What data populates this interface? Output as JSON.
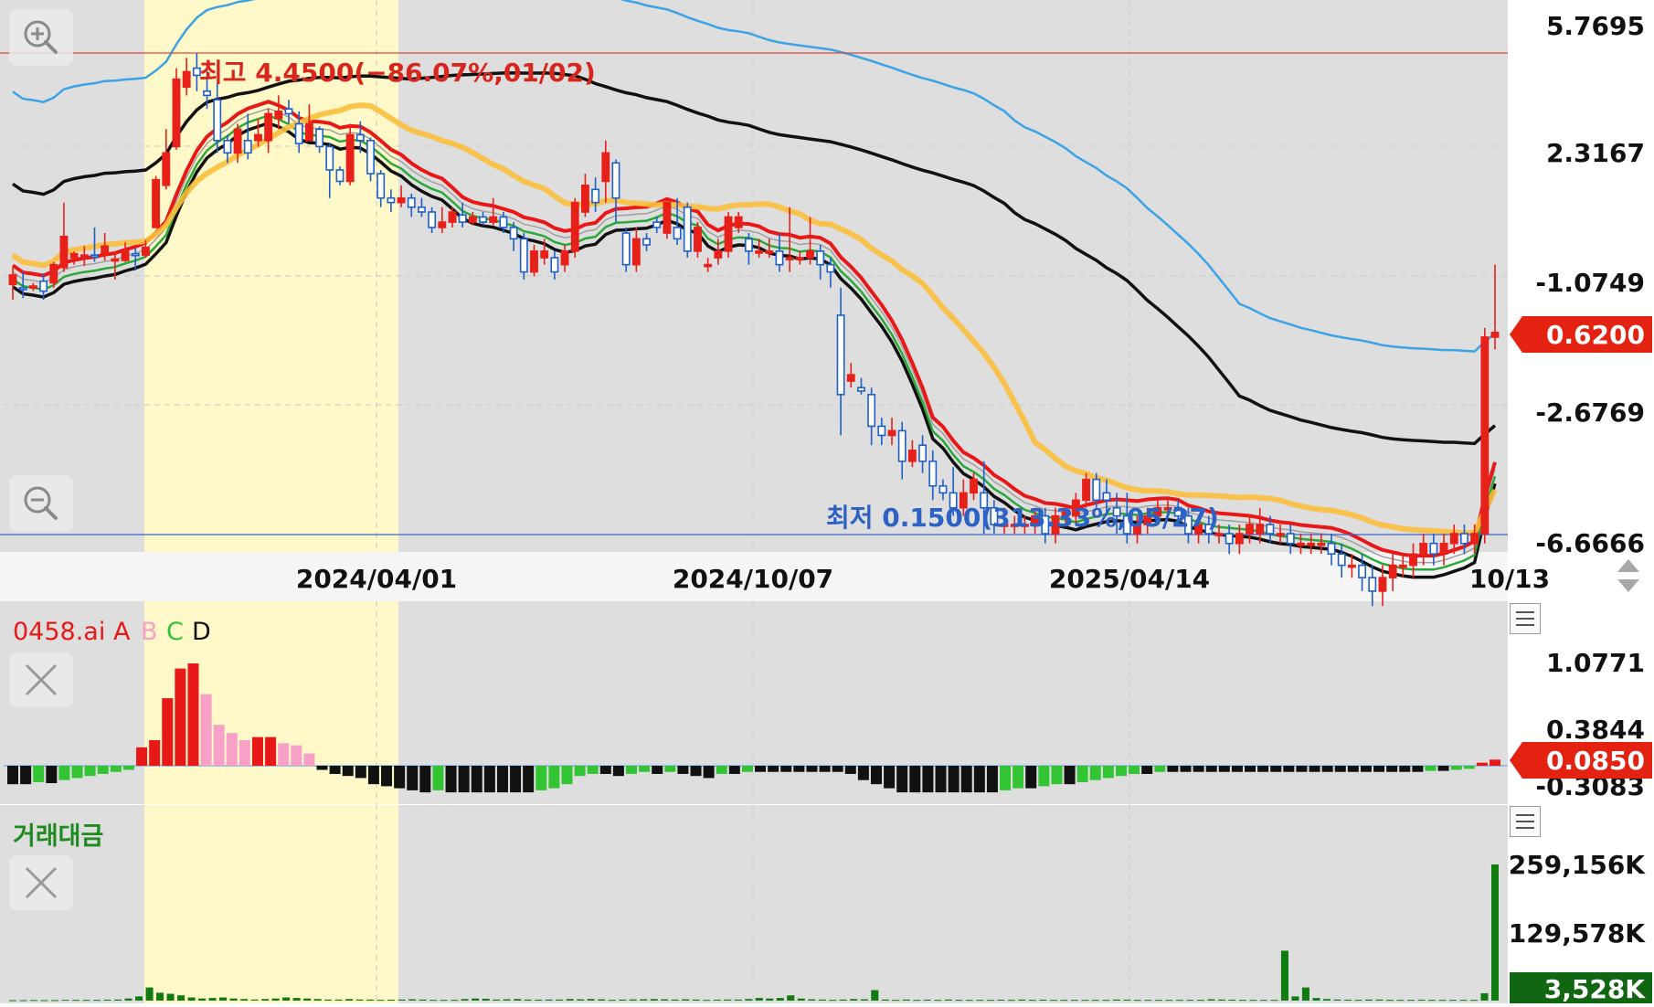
{
  "colors": {
    "up": "#e8201a",
    "down": "#1e5fc8",
    "panel_bg": "#dedede",
    "highlight_bg": "#fff8c8",
    "ma_yellow": "#fbbf3c",
    "ma_red": "#e81818",
    "ma_green": "#2aa838",
    "ma_gray": "#a0a0a0",
    "band_black": "#111111",
    "band_blue": "#3ba3e6",
    "osc_red": "#e81818",
    "osc_pink": "#f7a0c8",
    "osc_green": "#33c433",
    "osc_black": "#111111",
    "volume_green": "#107c10"
  },
  "icons": {
    "zoom_in": "zoom-in-icon",
    "zoom_out": "zoom-out-icon",
    "close": "close-icon",
    "menu": "menu-icon",
    "scroll": "up-down-arrows-icon"
  },
  "chart_data": [
    {
      "type": "candlestick",
      "name": "price",
      "y_axis_labels": [
        "5.7695",
        "2.3167",
        "-1.0749",
        "-2.6769",
        "-6.6666"
      ],
      "x_axis_labels": [
        "2024/04/01",
        "2024/10/07",
        "2025/04/14",
        "10/13"
      ],
      "current_price_label": "0.6200",
      "high_annotation": "최고 4.4500(−86.07%,01/02)",
      "low_annotation": "최저 0.1500(313.33%,05/27)",
      "high_value": 4.45,
      "low_value": 0.15,
      "current_value": 0.62,
      "candles": [
        [
          0.87,
          0.93,
          0.98,
          0.78
        ],
        [
          0.85,
          0.84,
          0.95,
          0.79
        ],
        [
          0.86,
          0.86,
          0.88,
          0.83
        ],
        [
          0.89,
          0.83,
          0.94,
          0.78
        ],
        [
          0.88,
          1.0,
          1.02,
          0.85
        ],
        [
          0.98,
          1.22,
          1.55,
          0.95
        ],
        [
          1.05,
          1.08,
          1.1,
          1.0
        ],
        [
          1.07,
          1.07,
          1.14,
          0.99
        ],
        [
          1.07,
          1.06,
          1.3,
          1.02
        ],
        [
          1.08,
          1.14,
          1.25,
          1.03
        ],
        [
          1.04,
          1.04,
          1.1,
          0.9
        ],
        [
          1.03,
          1.1,
          1.17,
          1.02
        ],
        [
          1.08,
          1.07,
          1.12,
          0.96
        ],
        [
          1.07,
          1.13,
          1.19,
          1.05
        ],
        [
          1.3,
          1.82,
          1.87,
          1.3
        ],
        [
          1.75,
          2.2,
          2.6,
          1.7
        ],
        [
          2.3,
          3.7,
          4.0,
          2.25
        ],
        [
          3.5,
          3.9,
          4.3,
          3.3
        ],
        [
          4.0,
          3.8,
          4.45,
          3.4
        ],
        [
          3.4,
          3.3,
          4.1,
          3.0
        ],
        [
          3.2,
          2.4,
          3.6,
          2.2
        ],
        [
          2.4,
          2.2,
          2.5,
          2.05
        ],
        [
          2.2,
          2.6,
          2.7,
          2.05
        ],
        [
          2.4,
          2.2,
          2.9,
          2.1
        ],
        [
          2.4,
          2.5,
          2.8,
          2.3
        ],
        [
          2.4,
          2.9,
          3.0,
          2.2
        ],
        [
          2.8,
          2.95,
          3.3,
          2.6
        ],
        [
          3.0,
          2.9,
          3.2,
          2.7
        ],
        [
          2.7,
          2.35,
          2.95,
          2.2
        ],
        [
          2.4,
          2.7,
          3.1,
          2.4
        ],
        [
          2.6,
          2.3,
          2.65,
          2.2
        ],
        [
          2.3,
          1.95,
          2.35,
          1.6
        ],
        [
          1.95,
          1.8,
          2.0,
          1.75
        ],
        [
          1.8,
          2.5,
          2.7,
          1.75
        ],
        [
          2.5,
          2.4,
          2.75,
          2.2
        ],
        [
          2.4,
          1.9,
          2.45,
          1.8
        ],
        [
          1.9,
          1.6,
          1.95,
          1.5
        ],
        [
          1.6,
          1.55,
          1.7,
          1.45
        ],
        [
          1.55,
          1.6,
          1.75,
          1.5
        ],
        [
          1.6,
          1.5,
          1.65,
          1.4
        ],
        [
          1.5,
          1.45,
          1.6,
          1.4
        ],
        [
          1.45,
          1.3,
          1.5,
          1.25
        ],
        [
          1.3,
          1.35,
          1.5,
          1.25
        ],
        [
          1.35,
          1.45,
          1.5,
          1.3
        ],
        [
          1.42,
          1.35,
          1.55,
          1.3
        ],
        [
          1.35,
          1.4,
          1.45,
          1.32
        ],
        [
          1.4,
          1.35,
          1.45,
          1.32
        ],
        [
          1.35,
          1.4,
          1.6,
          1.32
        ],
        [
          1.4,
          1.3,
          1.45,
          1.25
        ],
        [
          1.3,
          1.2,
          1.35,
          1.1
        ],
        [
          1.2,
          0.95,
          1.25,
          0.9
        ],
        [
          0.95,
          1.1,
          1.15,
          0.92
        ],
        [
          1.05,
          1.1,
          1.2,
          1.0
        ],
        [
          1.05,
          0.95,
          1.1,
          0.9
        ],
        [
          1.0,
          1.1,
          1.15,
          0.95
        ],
        [
          1.1,
          1.55,
          1.6,
          1.05
        ],
        [
          1.45,
          1.75,
          1.9,
          1.4
        ],
        [
          1.7,
          1.55,
          1.85,
          1.45
        ],
        [
          1.8,
          2.2,
          2.4,
          1.55
        ],
        [
          2.05,
          1.6,
          2.1,
          1.35
        ],
        [
          1.25,
          1.0,
          1.3,
          0.95
        ],
        [
          1.0,
          1.2,
          1.3,
          0.95
        ],
        [
          1.2,
          1.15,
          1.25,
          1.1
        ],
        [
          1.35,
          1.3,
          1.4,
          1.25
        ],
        [
          1.25,
          1.55,
          1.6,
          1.2
        ],
        [
          1.3,
          1.2,
          1.6,
          1.15
        ],
        [
          1.5,
          1.1,
          1.55,
          1.05
        ],
        [
          1.1,
          1.3,
          1.35,
          1.05
        ],
        [
          1.0,
          1.0,
          1.05,
          0.95
        ],
        [
          1.05,
          1.1,
          1.2,
          1.0
        ],
        [
          1.1,
          1.4,
          1.45,
          1.05
        ],
        [
          1.3,
          1.4,
          1.45,
          1.25
        ],
        [
          1.2,
          1.1,
          1.25,
          1.0
        ],
        [
          1.1,
          1.1,
          1.2,
          1.05
        ],
        [
          1.1,
          1.1,
          1.2,
          1.05
        ],
        [
          1.1,
          1.0,
          1.25,
          0.95
        ],
        [
          1.05,
          1.05,
          1.5,
          0.95
        ],
        [
          1.05,
          1.05,
          1.1,
          1.0
        ],
        [
          1.05,
          1.1,
          1.4,
          1.0
        ],
        [
          1.1,
          1.0,
          1.15,
          0.9
        ],
        [
          1.0,
          0.95,
          1.05,
          0.85
        ],
        [
          0.7,
          0.4,
          0.85,
          0.3
        ],
        [
          0.44,
          0.46,
          0.5,
          0.42
        ],
        [
          0.42,
          0.41,
          0.45,
          0.4
        ],
        [
          0.4,
          0.32,
          0.42,
          0.28
        ],
        [
          0.32,
          0.3,
          0.34,
          0.28
        ],
        [
          0.3,
          0.31,
          0.34,
          0.28
        ],
        [
          0.31,
          0.25,
          0.33,
          0.22
        ],
        [
          0.25,
          0.27,
          0.29,
          0.24
        ],
        [
          0.28,
          0.25,
          0.3,
          0.23
        ],
        [
          0.25,
          0.21,
          0.27,
          0.19
        ],
        [
          0.21,
          0.2,
          0.22,
          0.19
        ],
        [
          0.2,
          0.18,
          0.24,
          0.17
        ],
        [
          0.18,
          0.2,
          0.22,
          0.17
        ],
        [
          0.2,
          0.22,
          0.23,
          0.19
        ],
        [
          0.2,
          0.18,
          0.25,
          0.15
        ],
        [
          0.18,
          0.16,
          0.19,
          0.15
        ],
        [
          0.16,
          0.16,
          0.18,
          0.15
        ],
        [
          0.16,
          0.16,
          0.17,
          0.15
        ],
        [
          0.16,
          0.16,
          0.17,
          0.15
        ],
        [
          0.16,
          0.17,
          0.18,
          0.15
        ],
        [
          0.17,
          0.15,
          0.18,
          0.14
        ],
        [
          0.15,
          0.17,
          0.18,
          0.14
        ],
        [
          0.17,
          0.175,
          0.18,
          0.16
        ],
        [
          0.17,
          0.19,
          0.2,
          0.16
        ],
        [
          0.19,
          0.22,
          0.23,
          0.18
        ],
        [
          0.22,
          0.19,
          0.23,
          0.18
        ],
        [
          0.2,
          0.19,
          0.22,
          0.17
        ],
        [
          0.18,
          0.17,
          0.2,
          0.15
        ],
        [
          0.17,
          0.15,
          0.2,
          0.14
        ],
        [
          0.15,
          0.16,
          0.17,
          0.14
        ],
        [
          0.16,
          0.17,
          0.18,
          0.15
        ],
        [
          0.17,
          0.18,
          0.19,
          0.16
        ],
        [
          0.18,
          0.18,
          0.19,
          0.17
        ],
        [
          0.18,
          0.17,
          0.19,
          0.16
        ],
        [
          0.17,
          0.15,
          0.18,
          0.14
        ],
        [
          0.15,
          0.16,
          0.17,
          0.14
        ],
        [
          0.16,
          0.15,
          0.17,
          0.14
        ],
        [
          0.15,
          0.15,
          0.16,
          0.14
        ],
        [
          0.15,
          0.14,
          0.16,
          0.13
        ],
        [
          0.14,
          0.15,
          0.16,
          0.13
        ],
        [
          0.15,
          0.16,
          0.17,
          0.14
        ],
        [
          0.15,
          0.16,
          0.18,
          0.14
        ],
        [
          0.16,
          0.15,
          0.17,
          0.14
        ],
        [
          0.15,
          0.15,
          0.16,
          0.14
        ],
        [
          0.15,
          0.14,
          0.16,
          0.13
        ],
        [
          0.14,
          0.14,
          0.15,
          0.13
        ],
        [
          0.14,
          0.14,
          0.15,
          0.13
        ],
        [
          0.14,
          0.14,
          0.15,
          0.13
        ],
        [
          0.14,
          0.13,
          0.15,
          0.12
        ],
        [
          0.13,
          0.12,
          0.14,
          0.11
        ],
        [
          0.12,
          0.12,
          0.13,
          0.11
        ],
        [
          0.12,
          0.11,
          0.13,
          0.1
        ],
        [
          0.11,
          0.1,
          0.12,
          0.09
        ],
        [
          0.1,
          0.11,
          0.12,
          0.09
        ],
        [
          0.11,
          0.12,
          0.13,
          0.1
        ],
        [
          0.12,
          0.12,
          0.13,
          0.11
        ],
        [
          0.12,
          0.13,
          0.14,
          0.11
        ],
        [
          0.13,
          0.14,
          0.15,
          0.12
        ],
        [
          0.14,
          0.13,
          0.15,
          0.12
        ],
        [
          0.13,
          0.14,
          0.15,
          0.12
        ],
        [
          0.14,
          0.15,
          0.16,
          0.13
        ],
        [
          0.15,
          0.14,
          0.16,
          0.13
        ],
        [
          0.14,
          0.15,
          0.16,
          0.13
        ],
        [
          0.15,
          0.6,
          0.64,
          0.14
        ],
        [
          0.6,
          0.62,
          1.0,
          0.55
        ]
      ]
    },
    {
      "type": "bar",
      "name": "0458.ai",
      "legend": [
        "0458.ai",
        "A",
        "B",
        "C",
        "D"
      ],
      "y_axis_labels": [
        "1.0771",
        "0.3844",
        "-0.3083"
      ],
      "current_value_label": "0.0850",
      "values": [
        -0.18,
        -0.18,
        -0.16,
        -0.17,
        -0.14,
        -0.12,
        -0.1,
        -0.08,
        -0.06,
        -0.04,
        0.18,
        0.25,
        0.66,
        0.95,
        1.0,
        0.7,
        0.4,
        0.32,
        0.25,
        0.28,
        0.28,
        0.22,
        0.2,
        0.12,
        -0.04,
        -0.08,
        -0.1,
        -0.12,
        -0.18,
        -0.2,
        -0.22,
        -0.24,
        -0.26,
        -0.24,
        -0.26,
        -0.26,
        -0.26,
        -0.26,
        -0.26,
        -0.26,
        -0.26,
        -0.24,
        -0.22,
        -0.18,
        -0.1,
        -0.08,
        -0.08,
        -0.1,
        -0.08,
        -0.06,
        -0.08,
        -0.06,
        -0.08,
        -0.1,
        -0.12,
        -0.08,
        -0.08,
        -0.06,
        -0.06,
        -0.06,
        -0.06,
        -0.06,
        -0.06,
        -0.06,
        -0.06,
        -0.08,
        -0.14,
        -0.18,
        -0.22,
        -0.26,
        -0.26,
        -0.26,
        -0.26,
        -0.26,
        -0.26,
        -0.26,
        -0.26,
        -0.24,
        -0.22,
        -0.22,
        -0.2,
        -0.18,
        -0.18,
        -0.16,
        -0.14,
        -0.12,
        -0.1,
        -0.08,
        -0.08,
        -0.06,
        -0.06,
        -0.06,
        -0.06,
        -0.06,
        -0.06,
        -0.06,
        -0.06,
        -0.06,
        -0.06,
        -0.06,
        -0.06,
        -0.06,
        -0.06,
        -0.06,
        -0.06,
        -0.06,
        -0.06,
        -0.06,
        -0.06,
        -0.06,
        -0.05,
        -0.05,
        -0.04,
        -0.03,
        0.03,
        0.06
      ]
    },
    {
      "type": "bar",
      "name": "거래대금",
      "y_axis_labels": [
        "259,156K",
        "129,578K"
      ],
      "current_value_label": "3,528K",
      "values": [
        800,
        800,
        1200,
        900,
        1000,
        1600,
        1500,
        1400,
        1500,
        1800,
        2000,
        4000,
        8000,
        25000,
        15000,
        13000,
        10000,
        6000,
        4000,
        5000,
        6000,
        4000,
        3000,
        2000,
        3000,
        4000,
        6000,
        5000,
        4000,
        3000,
        2000,
        2000,
        3000,
        2000,
        2000,
        1500,
        1800,
        2000,
        2500,
        2000,
        1500,
        1500,
        1500,
        3000,
        4000,
        3500,
        2000,
        2500,
        3000,
        2000,
        1800,
        2000,
        2000,
        3000,
        2500,
        3000,
        2500,
        1500,
        2000,
        2200,
        2500,
        3000,
        2500,
        2000,
        2500,
        2000,
        1500,
        1800,
        2000,
        2000,
        3000,
        5000,
        4000,
        5000,
        10000,
        4000,
        2500,
        2000,
        1500,
        2000,
        3000,
        2500,
        20000,
        2000,
        1500,
        2000,
        1500,
        1800,
        1500,
        2000,
        1500,
        1500,
        1500,
        1500,
        1800,
        1500,
        2000,
        1500,
        1800,
        1500,
        1500,
        1500,
        1500,
        1500,
        1500,
        2000,
        1800,
        1500,
        1500,
        1500,
        1500,
        1500,
        1500,
        1500,
        2500,
        2000,
        1800,
        1500,
        1500,
        1500,
        1500,
        95000,
        8000,
        25000,
        5000,
        3000,
        2000,
        1800,
        1500,
        2000,
        2000,
        1500,
        1500,
        1500,
        1800,
        1500,
        1500,
        1500,
        1500,
        1500,
        14000,
        259156
      ]
    }
  ]
}
